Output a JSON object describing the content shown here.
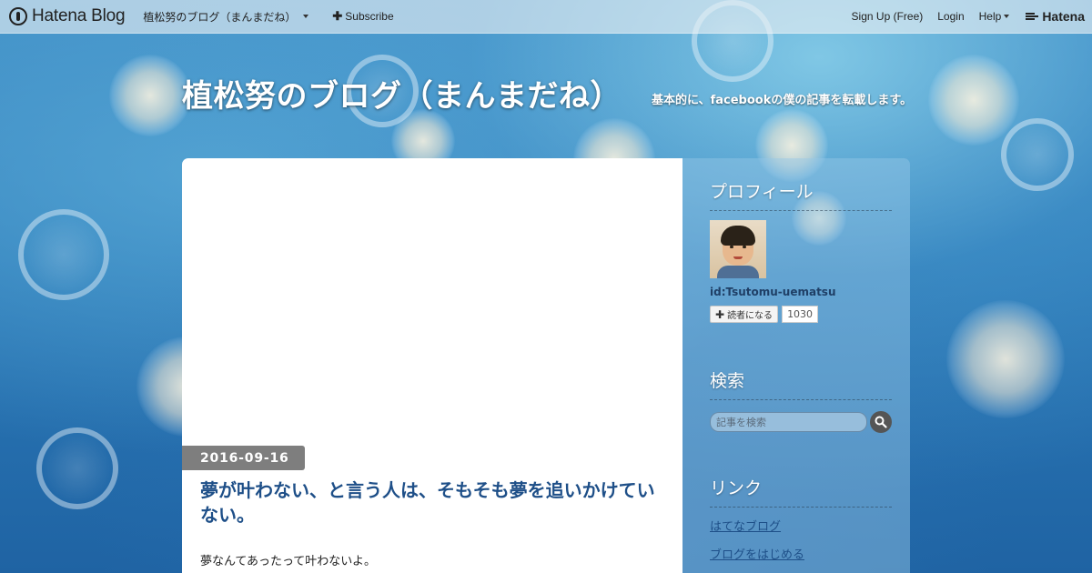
{
  "navbar": {
    "logo_text": "Hatena Blog",
    "blog_name": "植松努のブログ（まんまだね）",
    "subscribe_label": "Subscribe",
    "signup_label": "Sign Up (Free)",
    "login_label": "Login",
    "help_label": "Help",
    "hatena_label": "Hatena"
  },
  "header": {
    "title": "植松努のブログ（まんまだね）",
    "description": "基本的に、facebookの僕の記事を転載します。"
  },
  "entry": {
    "date": "2016-09-16",
    "title": "夢が叶わない、と言う人は、そもそも夢を追いかけていない。",
    "body_first_line": "夢なんてあったって叶わないよ。"
  },
  "sidebar": {
    "profile": {
      "title": "プロフィール",
      "user_id": "id:Tsutomu-uematsu",
      "reader_button": "読者になる",
      "reader_count": "1030"
    },
    "search": {
      "title": "検索",
      "placeholder": "記事を検索"
    },
    "links": {
      "title": "リンク",
      "items": [
        "はてなブログ",
        "ブログをはじめる"
      ]
    }
  },
  "colors": {
    "accent_title": "#1e4f88",
    "date_badge": "#7e7e7e",
    "background": "#2c7bb9"
  }
}
